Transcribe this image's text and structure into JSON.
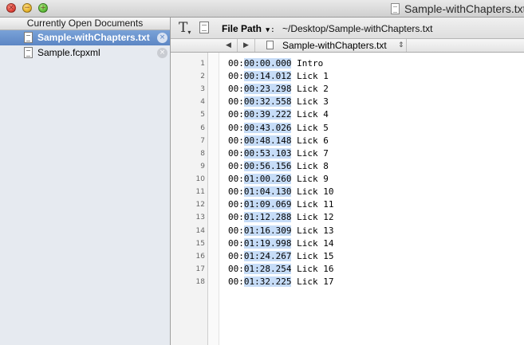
{
  "window": {
    "title": "Sample-withChapters.txt",
    "traffic": {
      "close": "×",
      "minimize": "−",
      "zoom": "+"
    }
  },
  "sidebar": {
    "header": "Currently Open Documents",
    "documents": [
      {
        "name": "Sample-withChapters.txt",
        "selected": true,
        "close": "×"
      },
      {
        "name": "Sample.fcpxml",
        "selected": false,
        "close": "×"
      }
    ]
  },
  "toolbar": {
    "text_icon": "T",
    "text_icon_sub": "▾",
    "path_label": "File Path",
    "path_triangle": "▾ :",
    "path_value": "~/Desktop/Sample-withChapters.txt"
  },
  "navbar": {
    "back": "◀",
    "forward": "▶",
    "file_name": "Sample-withChapters.txt",
    "popup": "⇕"
  },
  "editor": {
    "lines": [
      {
        "no": "1",
        "prefix": "00:",
        "sel": "00:00.000",
        "rest": " Intro"
      },
      {
        "no": "2",
        "prefix": "00:",
        "sel": "00:14.012",
        "rest": " Lick 1"
      },
      {
        "no": "3",
        "prefix": "00:",
        "sel": "00:23.298",
        "rest": " Lick 2"
      },
      {
        "no": "4",
        "prefix": "00:",
        "sel": "00:32.558",
        "rest": " Lick 3"
      },
      {
        "no": "5",
        "prefix": "00:",
        "sel": "00:39.222",
        "rest": " Lick 4"
      },
      {
        "no": "6",
        "prefix": "00:",
        "sel": "00:43.026",
        "rest": " Lick 5"
      },
      {
        "no": "7",
        "prefix": "00:",
        "sel": "00:48.148",
        "rest": " Lick 6"
      },
      {
        "no": "8",
        "prefix": "00:",
        "sel": "00:53.103",
        "rest": " Lick 7"
      },
      {
        "no": "9",
        "prefix": "00:",
        "sel": "00:56.156",
        "rest": " Lick 8"
      },
      {
        "no": "10",
        "prefix": "00:",
        "sel": "01:00.260",
        "rest": " Lick 9"
      },
      {
        "no": "11",
        "prefix": "00:",
        "sel": "01:04.130",
        "rest": " Lick 10"
      },
      {
        "no": "12",
        "prefix": "00:",
        "sel": "01:09.069",
        "rest": " Lick 11"
      },
      {
        "no": "13",
        "prefix": "00:",
        "sel": "01:12.288",
        "rest": " Lick 12"
      },
      {
        "no": "14",
        "prefix": "00:",
        "sel": "01:16.309",
        "rest": " Lick 13"
      },
      {
        "no": "15",
        "prefix": "00:",
        "sel": "01:19.998",
        "rest": " Lick 14"
      },
      {
        "no": "16",
        "prefix": "00:",
        "sel": "01:24.267",
        "rest": " Lick 15"
      },
      {
        "no": "17",
        "prefix": "00:",
        "sel": "01:28.254",
        "rest": " Lick 16"
      },
      {
        "no": "18",
        "prefix": "00:",
        "sel": "01:32.225",
        "rest": " Lick 17"
      }
    ]
  },
  "colors": {
    "selection": "#c6dcf7",
    "sidebar_selected": "#5c86c4",
    "sidebar_bg": "#e6eaf0"
  }
}
